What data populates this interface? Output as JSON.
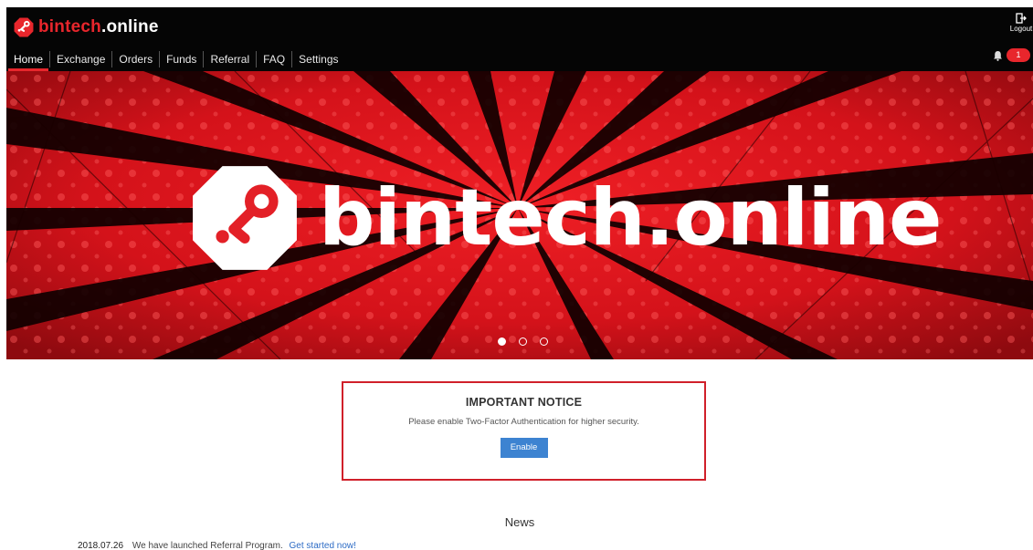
{
  "brand": {
    "name_part1": "bintech",
    "name_part2": ".online",
    "hero_text": "bintech.online",
    "accent_color": "#e8262c",
    "header_bg": "#050505"
  },
  "header": {
    "logout_label": "Logout",
    "notifications_count": "1",
    "nav": [
      {
        "label": "Home",
        "active": true
      },
      {
        "label": "Exchange"
      },
      {
        "label": "Orders"
      },
      {
        "label": "Funds"
      },
      {
        "label": "Referral"
      },
      {
        "label": "FAQ"
      },
      {
        "label": "Settings"
      }
    ]
  },
  "hero": {
    "slides_total": 3,
    "active_slide": 1
  },
  "notice": {
    "title": "IMPORTANT NOTICE",
    "message": "Please enable Two-Factor Authentication for higher security.",
    "button_label": "Enable",
    "border_color": "#d0202a",
    "button_color": "#3d83d1"
  },
  "news": {
    "title": "News",
    "items": [
      {
        "date": "2018.07.26",
        "text": "We have launched Referral Program.",
        "link": "Get started now!"
      }
    ]
  },
  "icons": [
    "logo-icon",
    "logout-icon",
    "bell-icon",
    "hero-logo-icon"
  ]
}
